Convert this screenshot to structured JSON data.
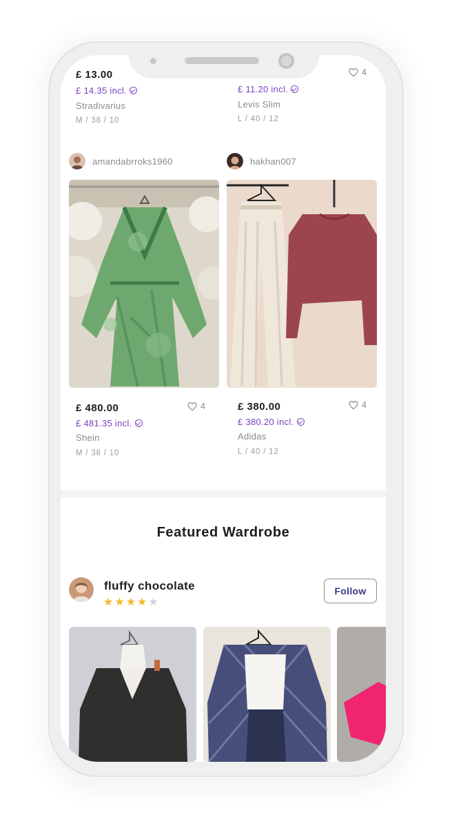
{
  "top_row": {
    "left": {
      "price": "£ 13.00",
      "price_incl": "£ 14.35 incl.",
      "brand": "Stradivarius",
      "size": "M / 38 / 10"
    },
    "right": {
      "likes": "4",
      "price_incl": "£ 11.20 incl.",
      "brand": "Levis Slim",
      "size": "L / 40 / 12"
    }
  },
  "products": [
    {
      "username": "amandabrroks1960",
      "price": "£ 480.00",
      "likes": "4",
      "price_incl": "£ 481.35 incl.",
      "brand": "Shein",
      "size": "M / 38 / 10"
    },
    {
      "username": "hakhan007",
      "price": "£ 380.00",
      "likes": "4",
      "price_incl": "£ 380.20 incl.",
      "brand": "Adidas",
      "size": "L / 40 / 12"
    }
  ],
  "featured": {
    "title": "Featured Wardrobe",
    "seller_name": "fluffy chocolate",
    "rating": 4,
    "rating_max": 5,
    "follow_label": "Follow"
  },
  "colors": {
    "accent": "#7b3fbf",
    "star": "#f5b928",
    "follow_text": "#3b3b8c"
  },
  "icons": [
    "heart-icon",
    "shield-check-icon",
    "star-icon"
  ]
}
